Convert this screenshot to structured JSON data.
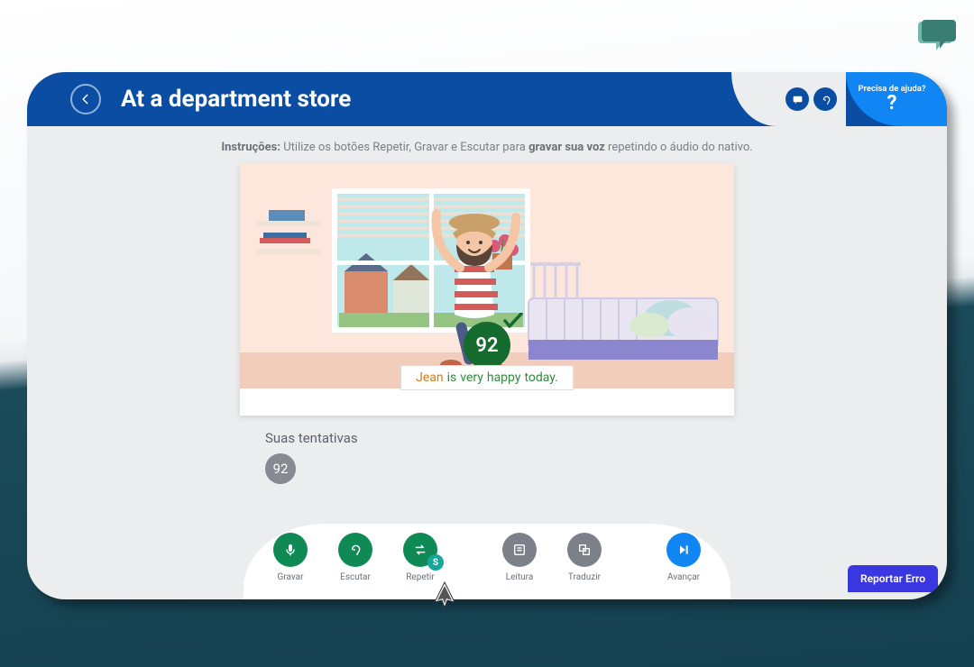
{
  "header": {
    "title": "At a department store",
    "help_text": "Precisa de ajuda?",
    "help_mark": "?"
  },
  "instructions": {
    "label": "Instruções:",
    "part1": " Utilize os botões Repetir, Gravar e Escutar para ",
    "bold": "gravar sua voz",
    "part2": " repetindo o áudio do nativo."
  },
  "score": {
    "value": "92"
  },
  "sentence": {
    "w1": "Jean",
    "w2": "is",
    "w3": "very",
    "w4": "happy",
    "w5": "today."
  },
  "attempts": {
    "label": "Suas tentativas",
    "values": [
      "92"
    ]
  },
  "dock": {
    "gravar": "Gravar",
    "escutar": "Escutar",
    "repetir": "Repetir",
    "repetir_badge": "S",
    "leitura": "Leitura",
    "traduzir": "Traduzir",
    "avancar": "Avançar"
  },
  "report_button": "Reportar Erro"
}
